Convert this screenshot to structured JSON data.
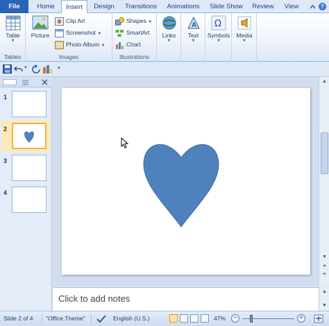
{
  "tabs": [
    {
      "label": "File",
      "kind": "file"
    },
    {
      "label": "Home",
      "kind": "normal"
    },
    {
      "label": "Insert",
      "kind": "active"
    },
    {
      "label": "Design",
      "kind": "normal"
    },
    {
      "label": "Transitions",
      "kind": "normal"
    },
    {
      "label": "Animations",
      "kind": "normal"
    },
    {
      "label": "Slide Show",
      "kind": "normal"
    },
    {
      "label": "Review",
      "kind": "normal"
    },
    {
      "label": "View",
      "kind": "normal"
    }
  ],
  "ribbon": {
    "tables": {
      "group_label": "Tables",
      "table_label": "Table"
    },
    "images": {
      "group_label": "Images",
      "picture_label": "Picture",
      "clip_art_label": "Clip Art",
      "screenshot_label": "Screenshot",
      "photo_album_label": "Photo Album"
    },
    "illustrations": {
      "group_label": "Illustrations",
      "shapes_label": "Shapes",
      "smartart_label": "SmartArt",
      "chart_label": "Chart"
    },
    "links_label": "Links",
    "text_label": "Text",
    "symbols_label": "Symbols",
    "media_label": "Media"
  },
  "thumbnails": [
    {
      "num": "1"
    },
    {
      "num": "2"
    },
    {
      "num": "3"
    },
    {
      "num": "4"
    }
  ],
  "notes_placeholder": "Click to add notes",
  "status": {
    "slide_info": "Slide 2 of 4",
    "theme": "\"Office Theme\"",
    "language": "English (U.S.)",
    "zoom": "47%"
  },
  "colors": {
    "heart_fill": "#4f81bd",
    "heart_stroke": "#3a6ea5",
    "file_tab": "#2a63b8",
    "selection": "#f2b43c"
  }
}
